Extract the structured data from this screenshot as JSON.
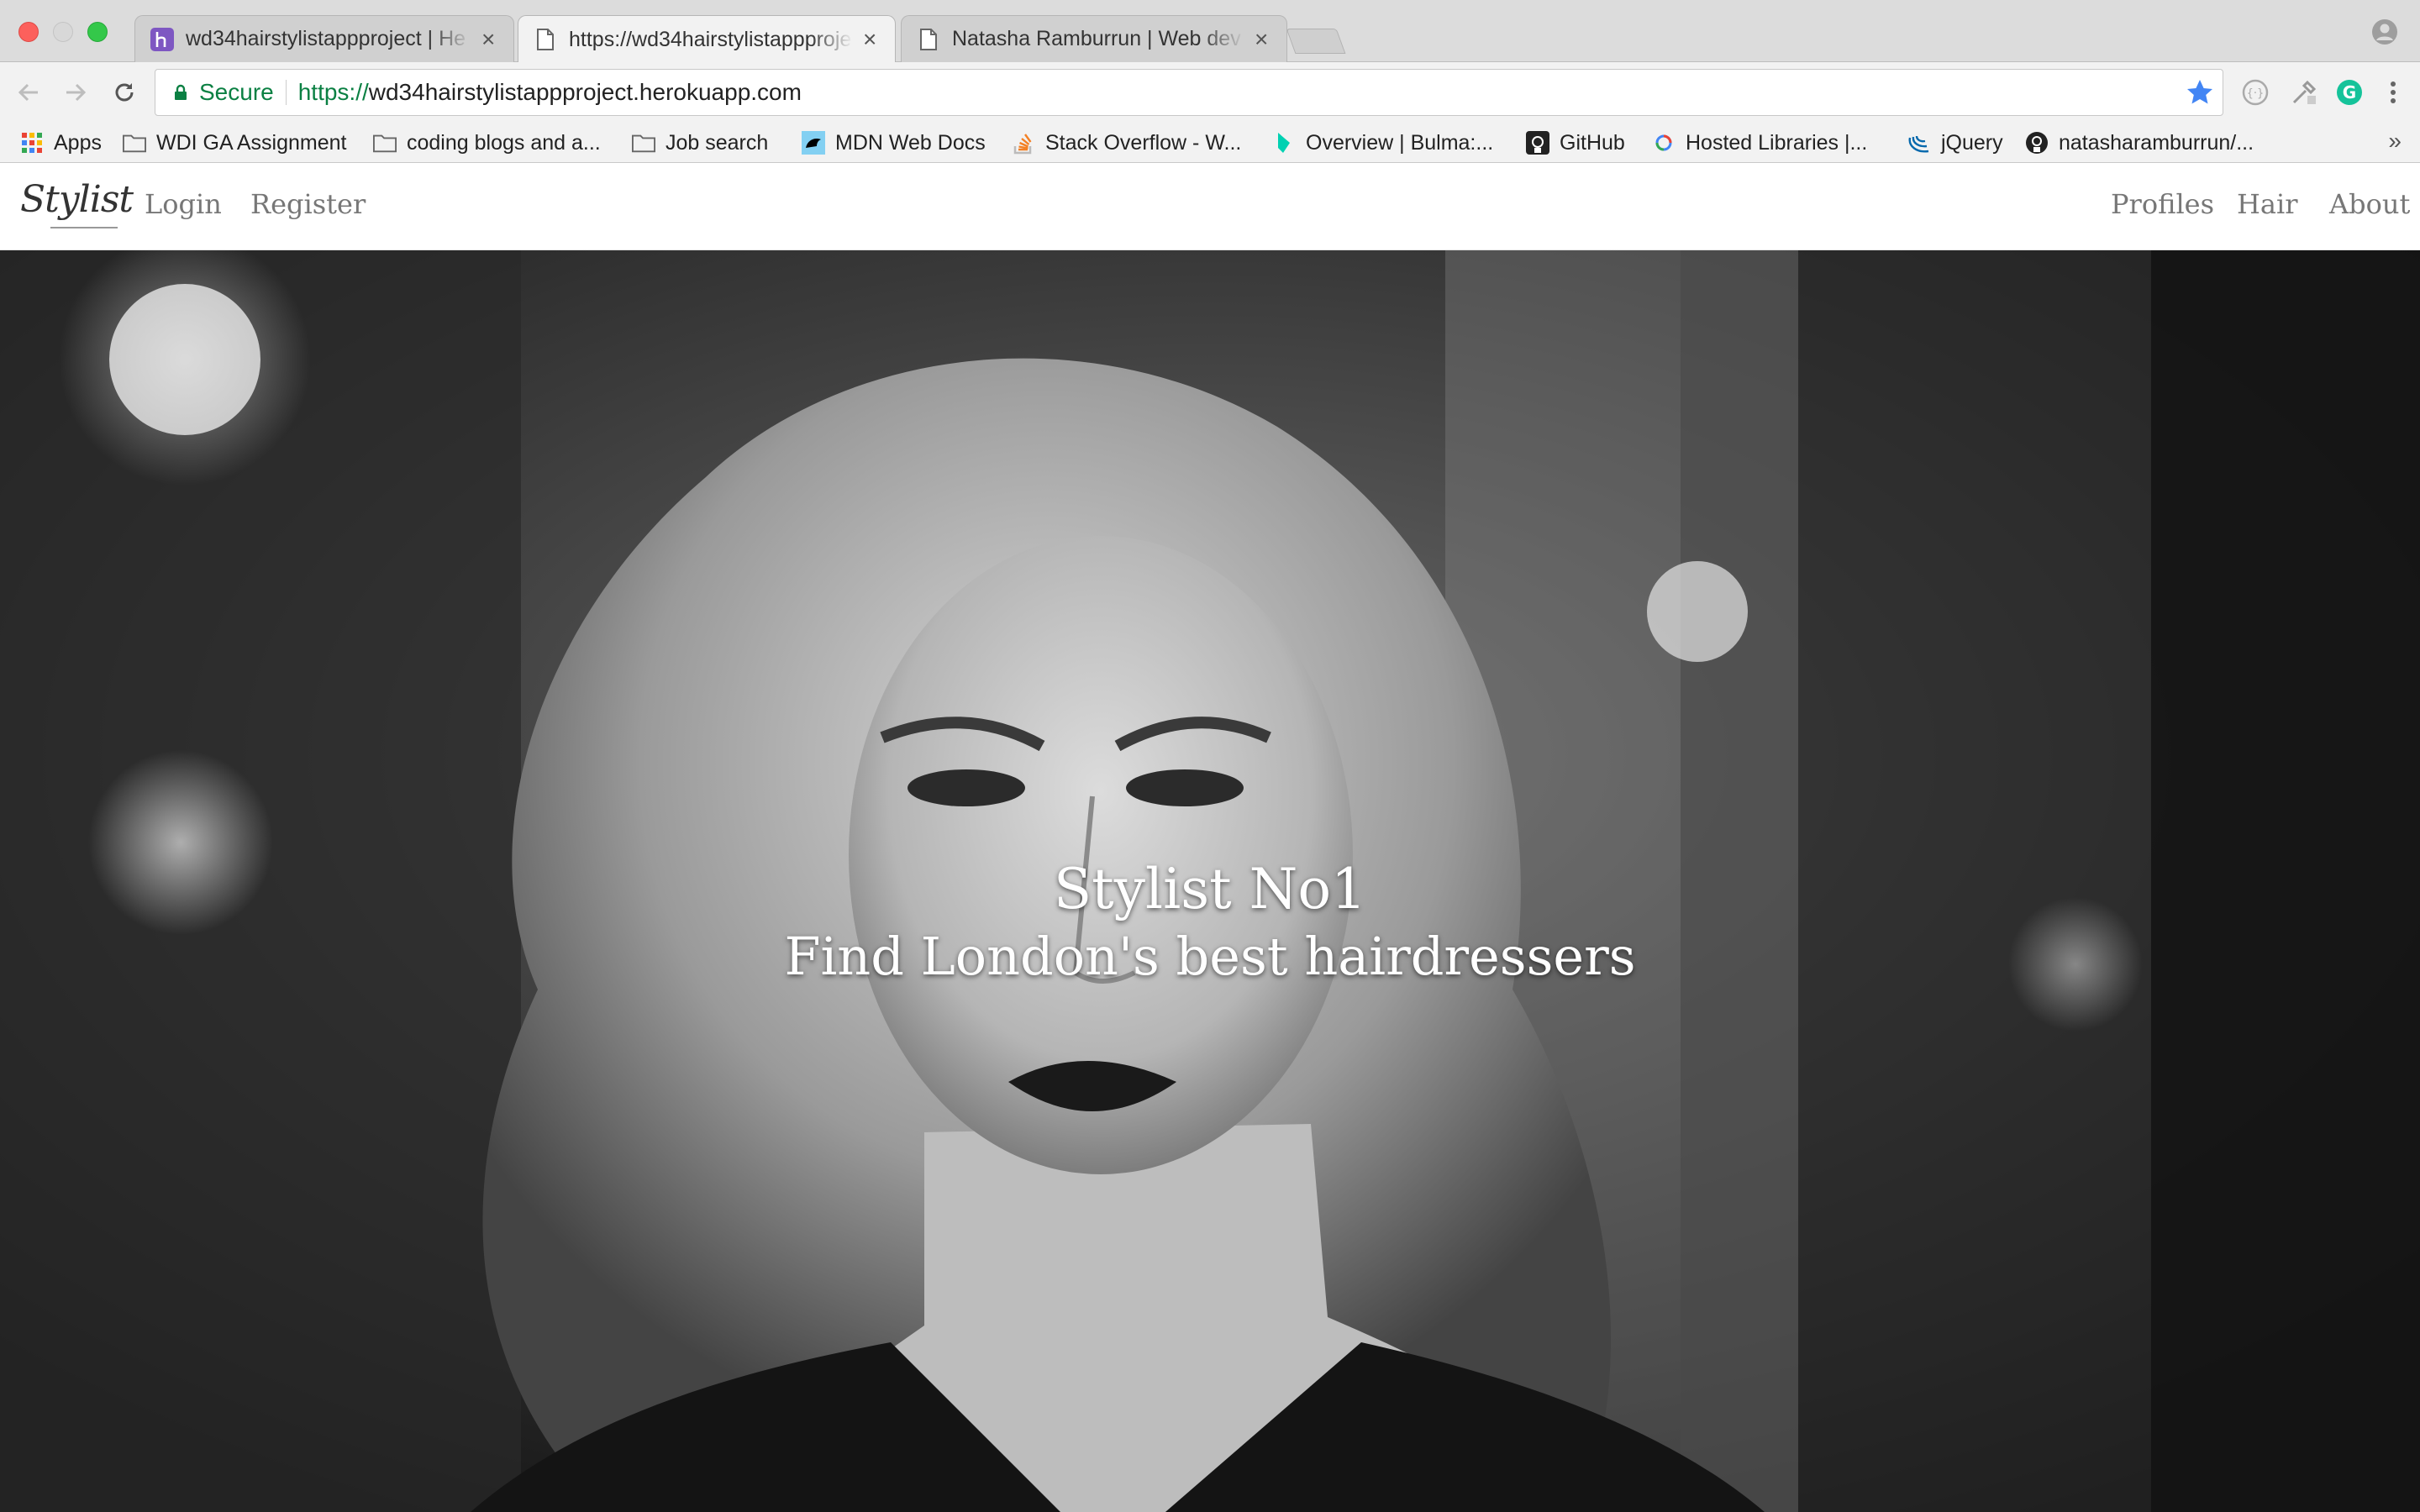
{
  "browser": {
    "tabs": [
      {
        "title": "wd34hairstylistappproject | He",
        "active": false
      },
      {
        "title": "https://wd34hairstylistappproje",
        "active": true
      },
      {
        "title": "Natasha Ramburrun | Web dev",
        "active": false
      }
    ],
    "address": {
      "secure_label": "Secure",
      "url_scheme": "https://",
      "url_host": "wd34hairstylistappproject.herokuapp.com"
    },
    "bookmarks": [
      {
        "label": "Apps",
        "icon": "apps-grid-icon"
      },
      {
        "label": "WDI GA Assignment",
        "icon": "folder-icon"
      },
      {
        "label": "coding blogs and a...",
        "icon": "folder-icon"
      },
      {
        "label": "Job search",
        "icon": "folder-icon"
      },
      {
        "label": "MDN Web Docs",
        "icon": "mdn-icon"
      },
      {
        "label": "Stack Overflow - W...",
        "icon": "stackoverflow-icon"
      },
      {
        "label": "Overview | Bulma:...",
        "icon": "bulma-icon"
      },
      {
        "label": "GitHub",
        "icon": "github-icon"
      },
      {
        "label": "Hosted Libraries  |...",
        "icon": "google-icon"
      },
      {
        "label": "jQuery",
        "icon": "jquery-icon"
      },
      {
        "label": "natasharamburrun/...",
        "icon": "github-icon"
      }
    ],
    "more": "»"
  },
  "site": {
    "logo": "Stylist",
    "nav_left": [
      "Login",
      "Register"
    ],
    "nav_right": [
      "Profiles",
      "Hair",
      "About"
    ],
    "hero": {
      "title": "Stylist No1",
      "subtitle": "Find London's best hairdressers"
    }
  },
  "colors": {
    "secure_green": "#0b8043",
    "star_blue": "#4285f4",
    "nav_link": "#777777"
  }
}
